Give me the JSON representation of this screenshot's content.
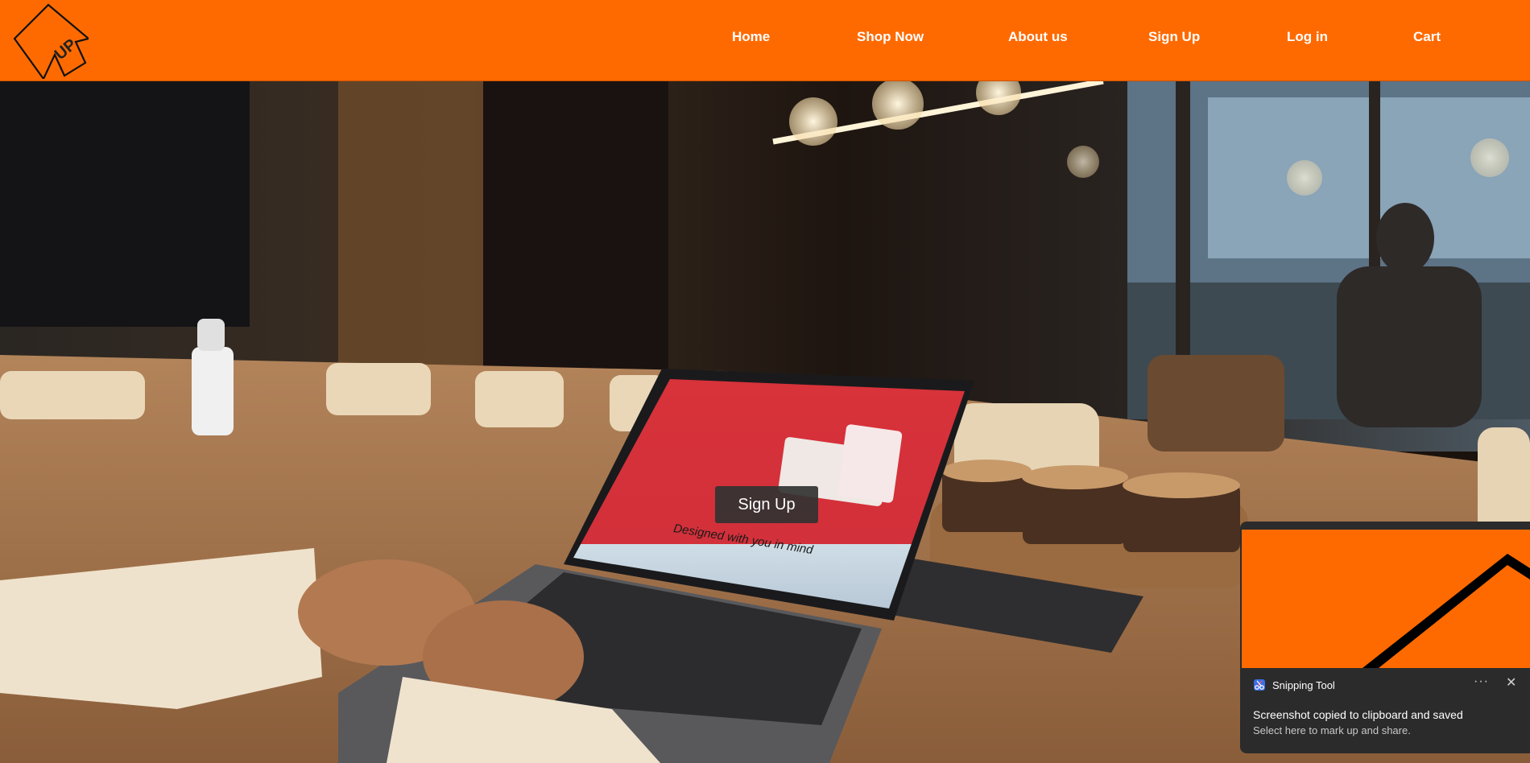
{
  "header": {
    "logo_text": "UP",
    "nav": [
      "Home",
      "Shop Now",
      "About us",
      "Sign Up",
      "Log in",
      "Cart"
    ]
  },
  "hero": {
    "signup_button": "Sign Up",
    "laptop_screen_text": "Designed with you in mind"
  },
  "notification": {
    "app_name": "Snipping Tool",
    "more_label": "···",
    "close_label": "✕",
    "title": "Screenshot copied to clipboard and saved",
    "body": "Select here to mark up and share."
  },
  "colors": {
    "brand_orange": "#ff6a00",
    "toast_bg": "#2b2b2b"
  },
  "icons": {
    "logo": "arrow-up-logo-icon",
    "app": "snipping-tool-icon",
    "more": "more-icon",
    "close": "close-icon"
  }
}
